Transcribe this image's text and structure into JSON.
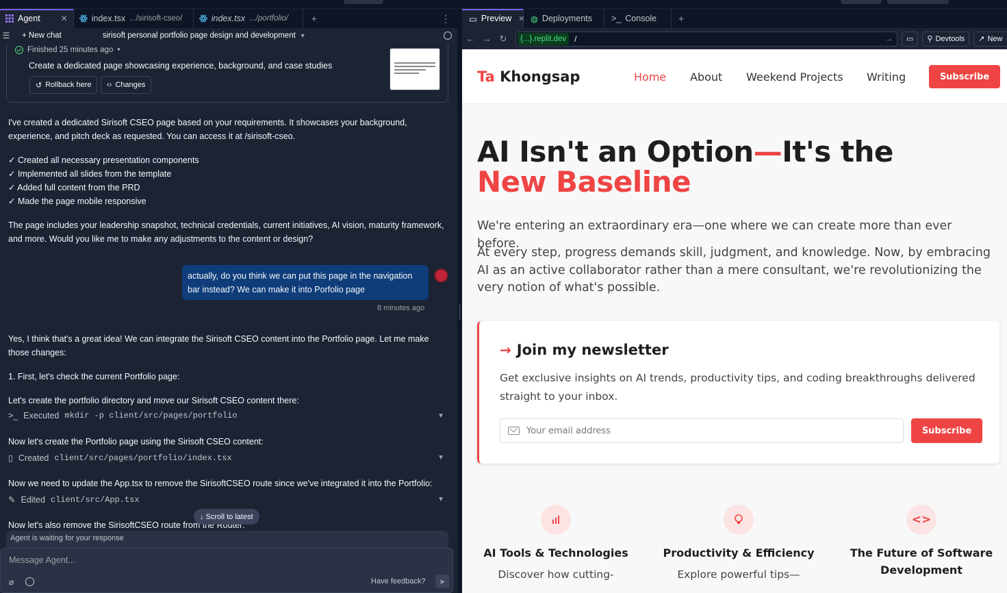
{
  "agent_panel": {
    "tabs": [
      {
        "label": "Agent",
        "sub": ""
      },
      {
        "label": "index.tsx",
        "sub": ".../sirisoft-cseo/"
      },
      {
        "label": "index.tsx",
        "sub": ".../portfolio/"
      }
    ],
    "new_chat_label": "New chat",
    "chat_title": "sirisoft personal portfolio page design and development",
    "checkpoint": {
      "status": "Finished 25 minutes ago",
      "description": "Create a dedicated page showcasing experience, background, and case studies",
      "rollback_label": "Rollback here",
      "changes_label": "Changes"
    },
    "agent_message_1": "I've created a dedicated Sirisoft CSEO page based on your requirements. It showcases your background, experience, and pitch deck as requested. You can access it at /sirisoft-cseo.",
    "checklist": [
      "✓ Created all necessary presentation components",
      "✓ Implemented all slides from the template",
      "✓ Added full content from the PRD",
      "✓ Made the page mobile responsive"
    ],
    "agent_message_2": "The page includes your leadership snapshot, technical credentials, current initiatives, AI vision, maturity framework, and more. Would you like me to make any adjustments to the content or design?",
    "user_message": "actually, do you think we can put this page in the navigation bar instead? We can make it into Porfolio page",
    "user_time": "8 minutes ago",
    "agent_reply": "Yes, I think that's a great idea! We can integrate the Sirisoft CSEO content into the Portfolio page. Let me make those changes:",
    "step_1": "1. First, let's check the current Portfolio page:",
    "step_2": "Let's create the portfolio directory and move our Sirisoft CSEO content there:",
    "action_1": {
      "verb": "Executed",
      "detail": "mkdir -p client/src/pages/portfolio"
    },
    "step_3": "Now let's create the Portfolio page using the Sirisoft CSEO content:",
    "action_2": {
      "verb": "Created",
      "detail": "client/src/pages/portfolio/index.tsx"
    },
    "step_4": "Now we need to update the App.tsx to remove the SirisoftCSEO route since we've integrated it into the Portfolio:",
    "action_3": {
      "verb": "Edited",
      "detail": "client/src/App.tsx"
    },
    "step_5": "Now let's also remove the SirisoftCSEO route from the Router:",
    "scroll_label": "↓ Scroll to latest",
    "waiting_text": "Agent is waiting for your response",
    "message_placeholder": "Message Agent...",
    "feedback_label": "Have feedback?"
  },
  "preview_panel": {
    "tabs": [
      "Preview",
      "Deployments",
      "Console"
    ],
    "url_host": "{...}.replit.dev",
    "url_path": "/",
    "devtools_label": "Devtools",
    "new_tab_label": "New"
  },
  "site": {
    "logo_first": "Ta",
    "logo_rest": "Khongsap",
    "nav": [
      "Home",
      "About",
      "Weekend Projects",
      "Writing"
    ],
    "subscribe_label": "Subscribe",
    "hero_part1": "AI Isn't an Option",
    "hero_dash": "—",
    "hero_part2": "It's the ",
    "hero_red": "New Baseline",
    "lead_1": "We're entering an extraordinary era—one where we can create more than ever before.",
    "lead_2": "At every step, progress demands skill, judgment, and knowledge. Now, by embracing AI as an active collaborator rather than a mere consultant, we're revolutionizing the very notion of what's possible.",
    "newsletter": {
      "title": "Join my newsletter",
      "text": "Get exclusive insights on AI trends, productivity tips, and coding breakthroughs delivered straight to your inbox.",
      "placeholder": "Your email address",
      "button": "Subscribe"
    },
    "features": [
      {
        "title": "AI Tools & Technologies",
        "desc": "Discover how cutting-"
      },
      {
        "title": "Productivity & Efficiency",
        "desc": "Explore powerful tips—"
      },
      {
        "title": "The Future of Software Development",
        "desc": ""
      }
    ],
    "accent_color": "#ef4444"
  }
}
